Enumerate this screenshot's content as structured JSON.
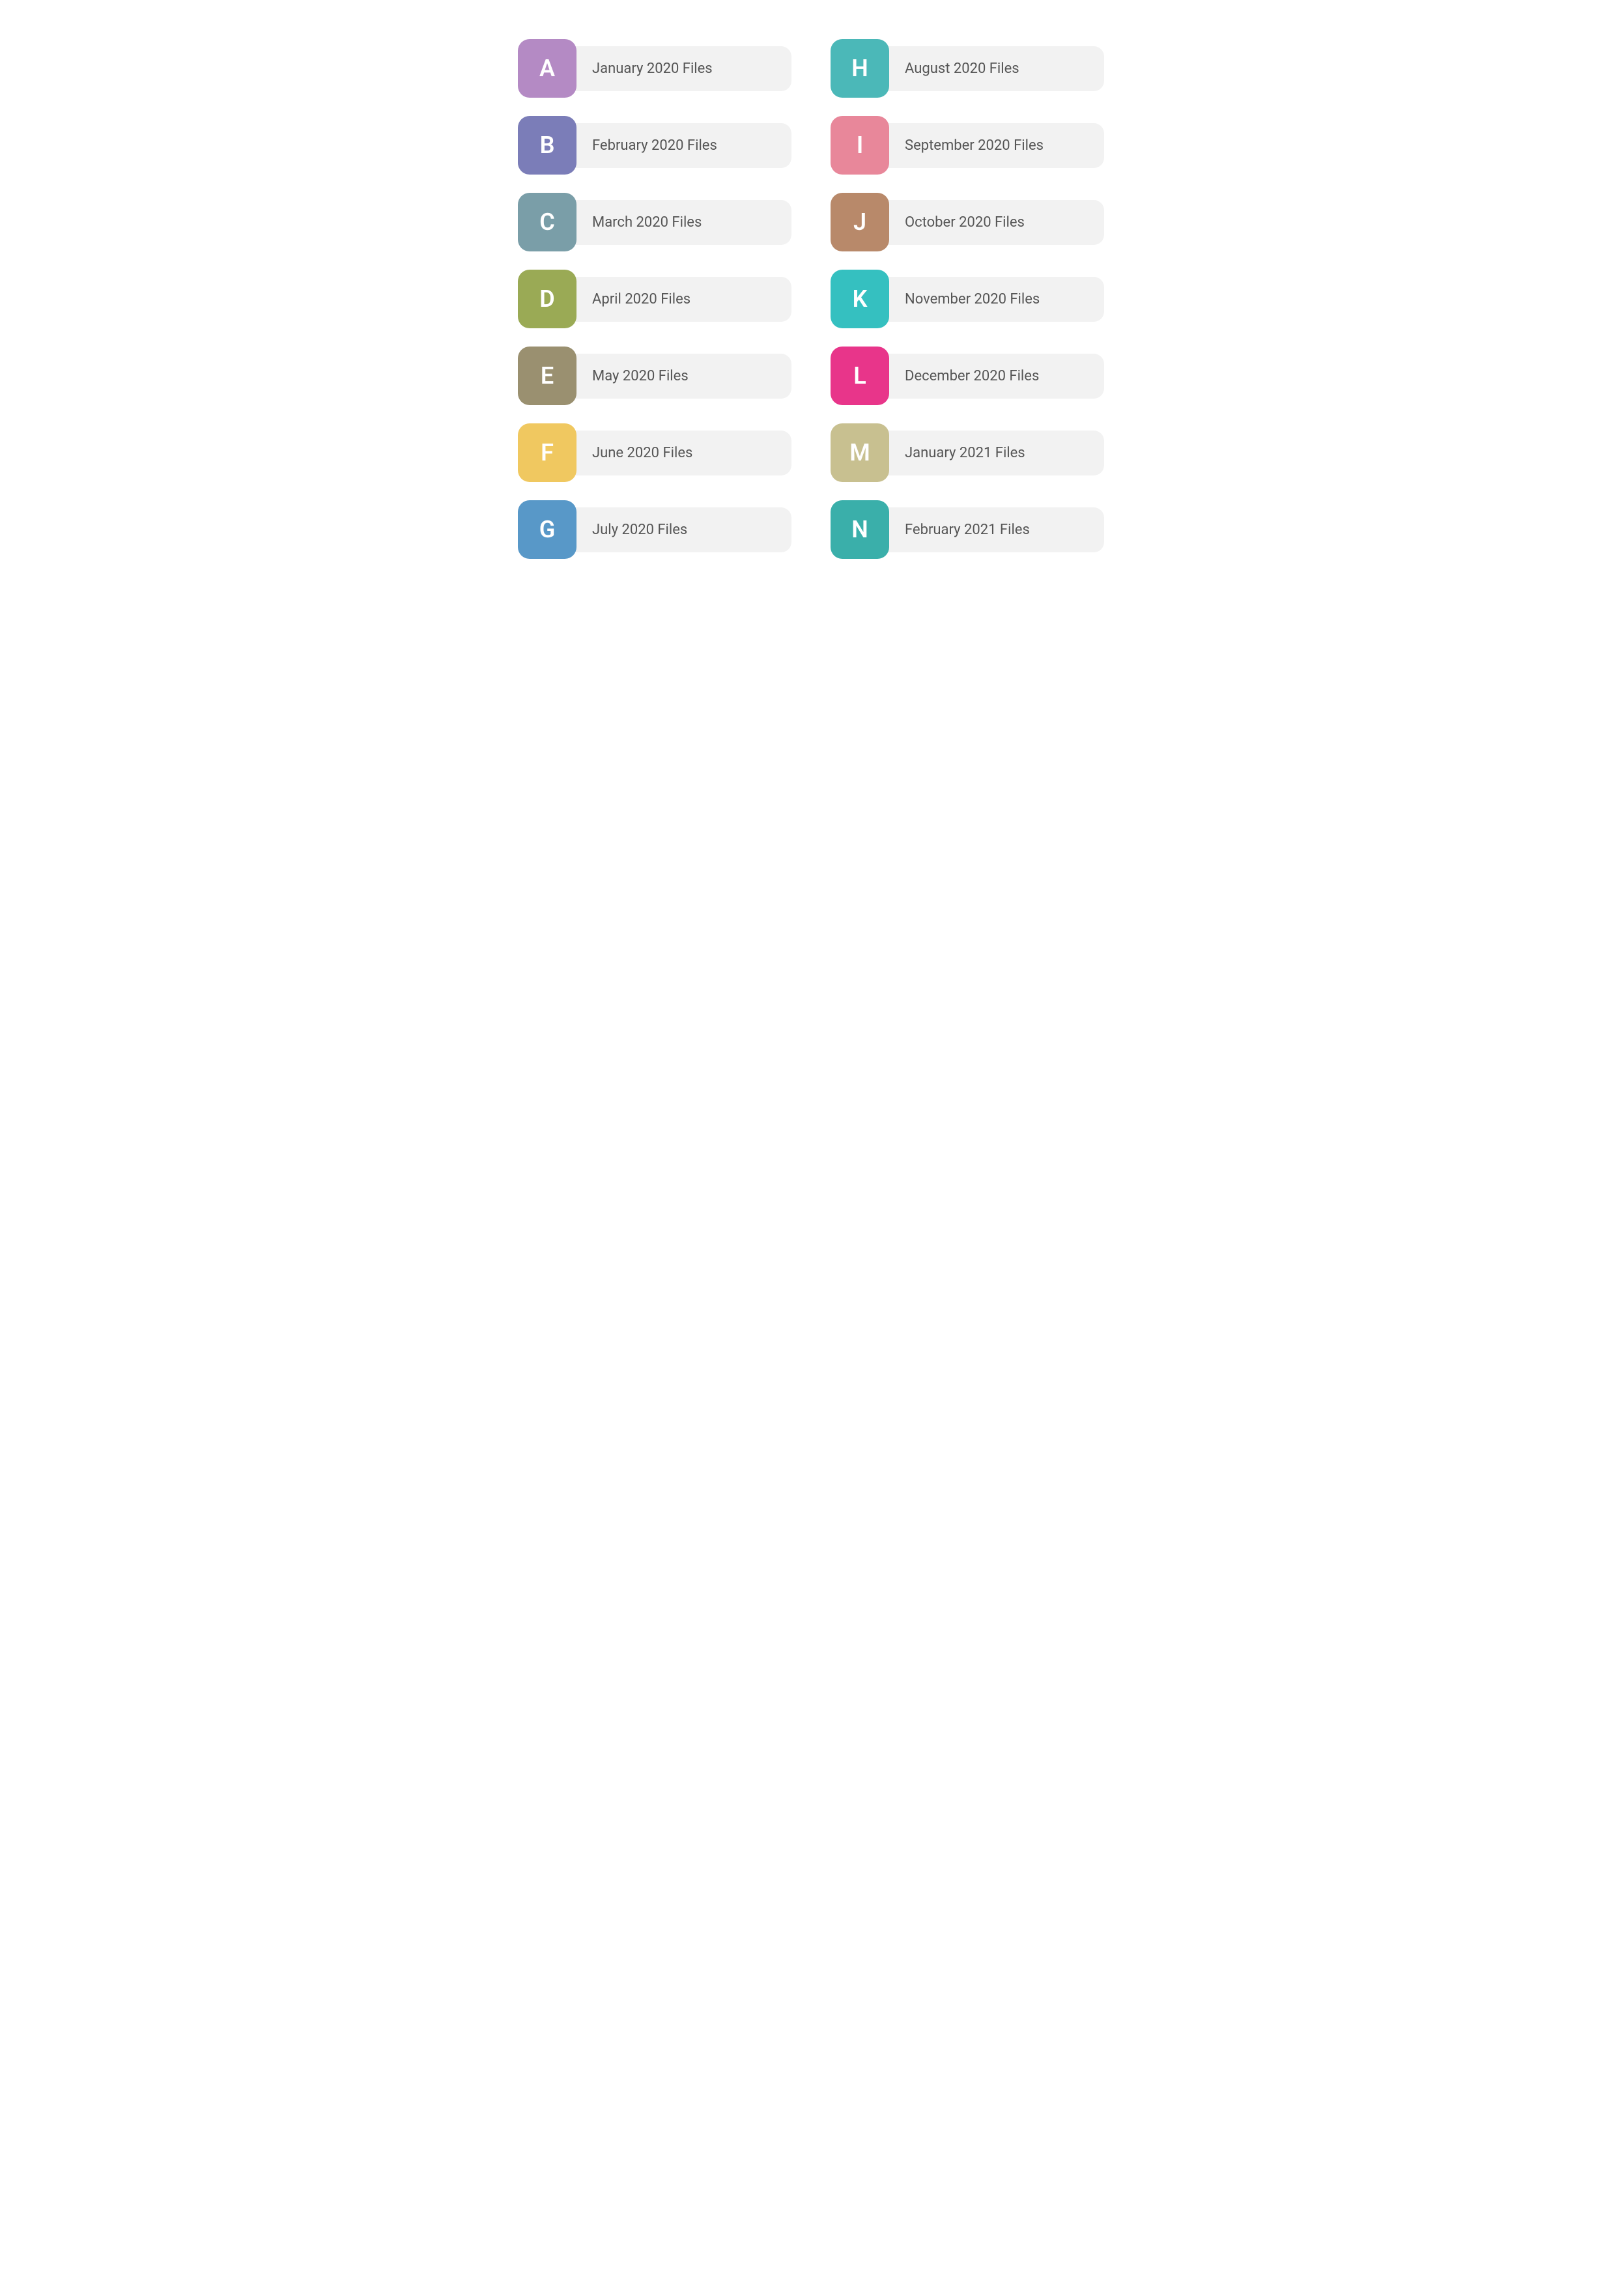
{
  "folders": [
    {
      "id": "a",
      "letter": "A",
      "label": "January 2020 Files",
      "color": "#b48ac4"
    },
    {
      "id": "h",
      "letter": "H",
      "label": "August 2020 Files",
      "color": "#4bb8b8"
    },
    {
      "id": "b",
      "letter": "B",
      "label": "February 2020 Files",
      "color": "#7b7db8"
    },
    {
      "id": "i",
      "letter": "I",
      "label": "September 2020 Files",
      "color": "#e8879a"
    },
    {
      "id": "c",
      "letter": "C",
      "label": "March 2020 Files",
      "color": "#7a9ea8"
    },
    {
      "id": "j",
      "letter": "J",
      "label": "October 2020 Files",
      "color": "#b8896a"
    },
    {
      "id": "d",
      "letter": "D",
      "label": "April 2020 Files",
      "color": "#9aaa55"
    },
    {
      "id": "k",
      "letter": "K",
      "label": "November 2020 Files",
      "color": "#35c0c0"
    },
    {
      "id": "e",
      "letter": "E",
      "label": "May 2020 Files",
      "color": "#9a9070"
    },
    {
      "id": "l",
      "letter": "L",
      "label": "December 2020 Files",
      "color": "#e8358a"
    },
    {
      "id": "f",
      "letter": "F",
      "label": "June 2020 Files",
      "color": "#f0c860"
    },
    {
      "id": "m",
      "letter": "M",
      "label": "January 2021 Files",
      "color": "#c8c090"
    },
    {
      "id": "g",
      "letter": "G",
      "label": "July 2020 Files",
      "color": "#5898c8"
    },
    {
      "id": "n",
      "letter": "N",
      "label": "February 2021 Files",
      "color": "#3aafaa"
    }
  ]
}
